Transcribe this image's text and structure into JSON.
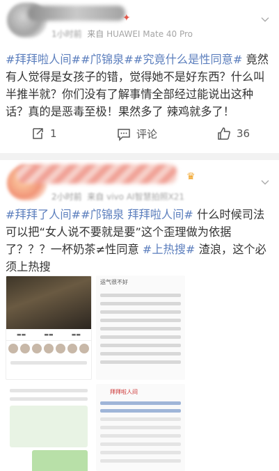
{
  "post1": {
    "time": "1小时前",
    "source_prefix": "来自",
    "source": "HUAWEI Mate 40 Pro",
    "text_parts": [
      {
        "type": "tag",
        "text": "#拜拜啦人间#"
      },
      {
        "type": "tag",
        "text": "#邝锦泉#"
      },
      {
        "type": "tag",
        "text": "#究竟什么是性同意#"
      },
      {
        "type": "plain",
        "text": " 竟然有人觉得是女孩子的错，觉得她不是好东西？什么叫半推半就？你们没有了解事情全部经过能说出这种话？真的是恶毒至极！果然多了 辣鸡就多了！"
      }
    ],
    "actions": {
      "repost_count": "1",
      "comment_label": "评论",
      "like_count": "36"
    }
  },
  "post2": {
    "time": "2小时前",
    "source_prefix": "来自",
    "source": "vivo AI智慧拍照X21",
    "text_parts": [
      {
        "type": "tag",
        "text": "#拜拜了人间#"
      },
      {
        "type": "tag",
        "text": "#邝锦泉 拜拜啦人间#"
      },
      {
        "type": "plain",
        "text": " 什么时候司法可以把“女人说不要就是要”这个歪理做为依据了？？？一杯奶茶≠性同意 "
      },
      {
        "type": "tag",
        "text": "#上热搜#"
      },
      {
        "type": "plain",
        "text": " 渣浪，这个必须上热搜"
      }
    ],
    "images": [
      {
        "caption": "运气很不好"
      },
      {
        "caption": ""
      },
      {
        "caption": ""
      },
      {
        "caption": "拜拜啦人间"
      }
    ]
  },
  "colors": {
    "tag": "#5b7ebd",
    "text": "#333333",
    "meta": "#9a9a9a",
    "divider": "#f2f2f2"
  }
}
